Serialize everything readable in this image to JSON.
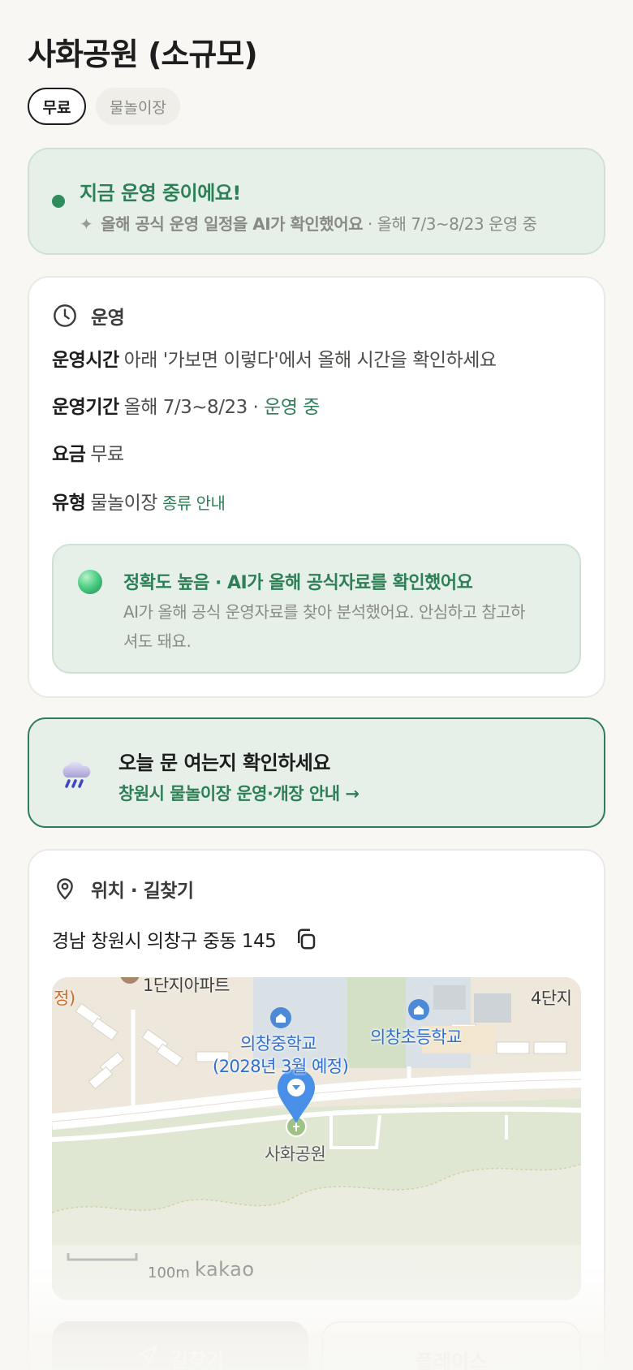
{
  "header": {
    "title": "사화공원 (소규모)",
    "chips": [
      {
        "label": "무료"
      },
      {
        "label": "물놀이장"
      }
    ]
  },
  "status": {
    "title": "지금 운영 중이에요!",
    "sub_bold": "올해 공식 운영 일정을 AI가 확인했어요",
    "sub_rest": " · 올해 7/3~8/23 운영 중",
    "dot_color": "#2e8b5c",
    "sparkle_icon": "sparkle-icon"
  },
  "operation": {
    "section_label": "운영",
    "icon": "clock-icon",
    "hours_key": "운영시간",
    "hours_value": "아래 '가보면 이렇다'에서 올해 시간을 확인하세요",
    "period_key": "운영기간",
    "period_value": "올해 7/3~8/23 · ",
    "period_status": "운영 중",
    "fee_key": "요금",
    "fee_value": "무료",
    "type_key": "유형",
    "type_value": "물놀이장",
    "type_link": "종류 안내",
    "accuracy": {
      "title": "정확도 높음 · AI가 올해 공식자료를 확인했어요",
      "desc": "AI가 올해 공식 운영자료를 찾아 분석했어요. 안심하고 참고하셔도 돼요."
    }
  },
  "today": {
    "title": "오늘 문 여는지 확인하세요",
    "link": "창원시 물놀이장 운영·개장 안내 →",
    "icon": "rain-cloud-icon"
  },
  "location": {
    "section_label": "위치 · 길찾기",
    "icon": "map-pin-icon",
    "address": "경남 창원시 의창구 중동 145",
    "copy_icon": "copy-icon",
    "map": {
      "labels": {
        "apartment": "1단지아파트",
        "edge_left": "정)",
        "apt4": "4단지",
        "school_middle": "의창중학교",
        "school_middle_note": "(2028년 3월 예정)",
        "school_elem": "의창초등학교",
        "park": "사화공원"
      },
      "scale": "100m",
      "provider": "kakao"
    }
  },
  "actions": {
    "directions": "길찾기",
    "place": "플레이스"
  },
  "colors": {
    "accent_green": "#2d7f55",
    "card_green_bg": "#e6efe8",
    "page_bg": "#f8f7f3"
  }
}
